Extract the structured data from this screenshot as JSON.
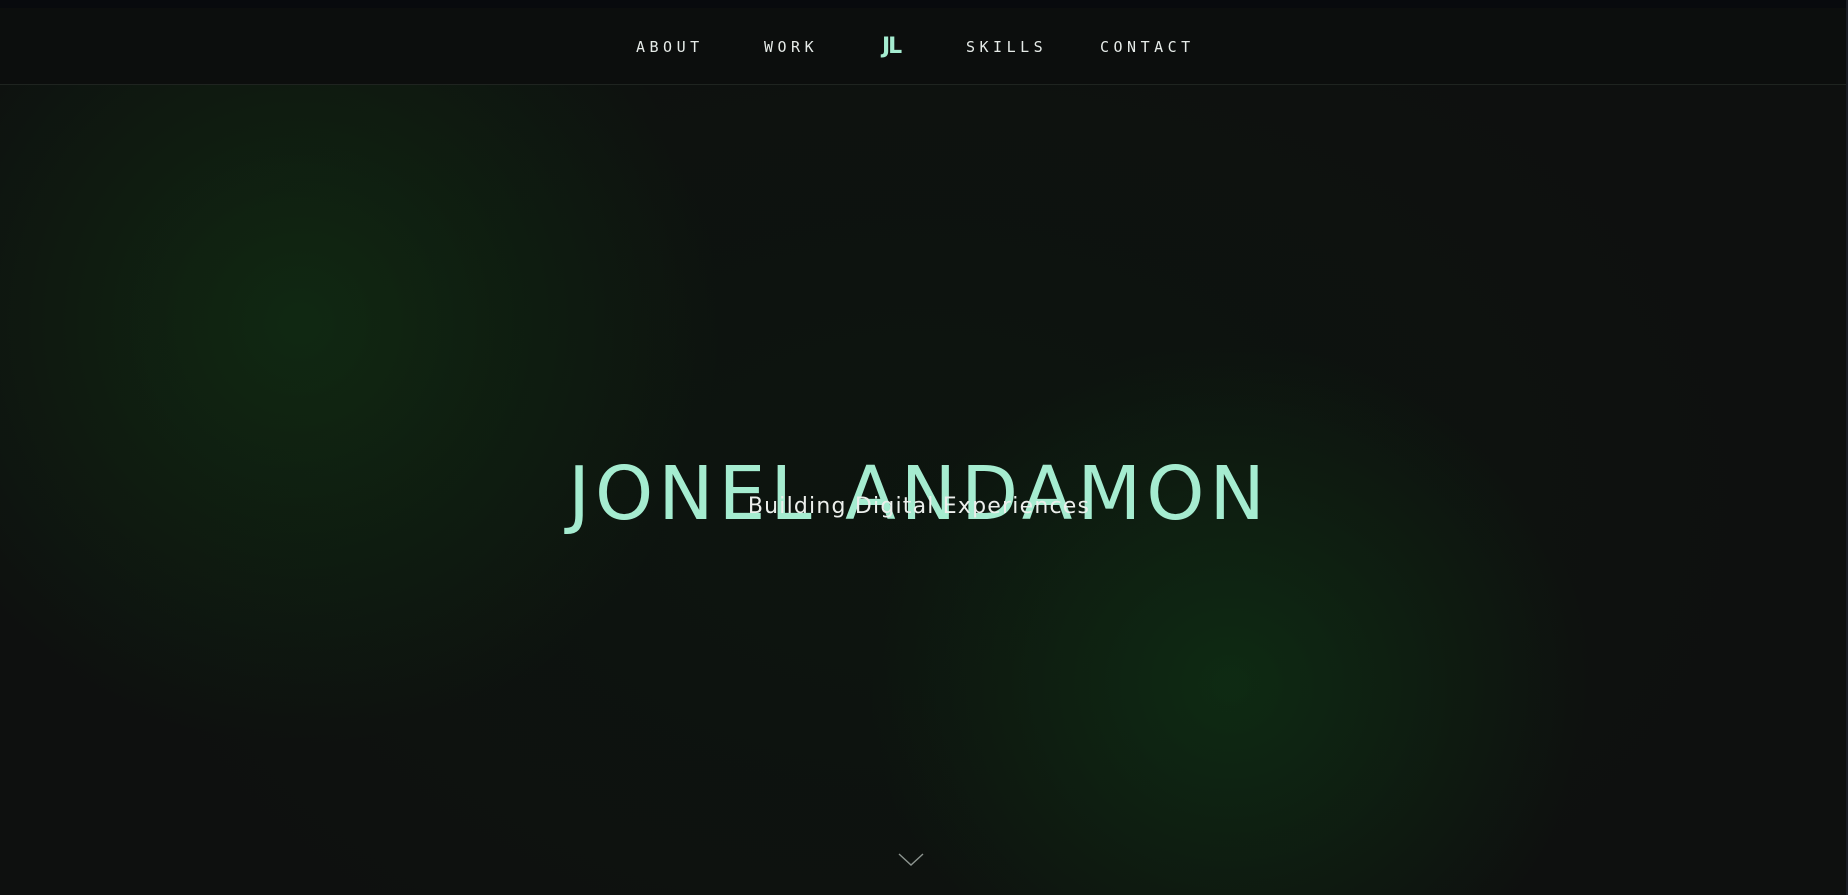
{
  "nav": {
    "links": [
      {
        "label": "ABOUT"
      },
      {
        "label": "WORK"
      },
      {
        "label": "SKILLS"
      },
      {
        "label": "CONTACT"
      }
    ],
    "logo": "JL"
  },
  "hero": {
    "title": "JONEL ANDAMON",
    "subtitle": "Building Digital Experiences"
  },
  "icons": {
    "scroll": "chevron-down-icon"
  },
  "colors": {
    "accent": "#a5ecd0",
    "background": "#0d0f0e",
    "text": "#e6ebe8",
    "glow": "#123c14"
  }
}
